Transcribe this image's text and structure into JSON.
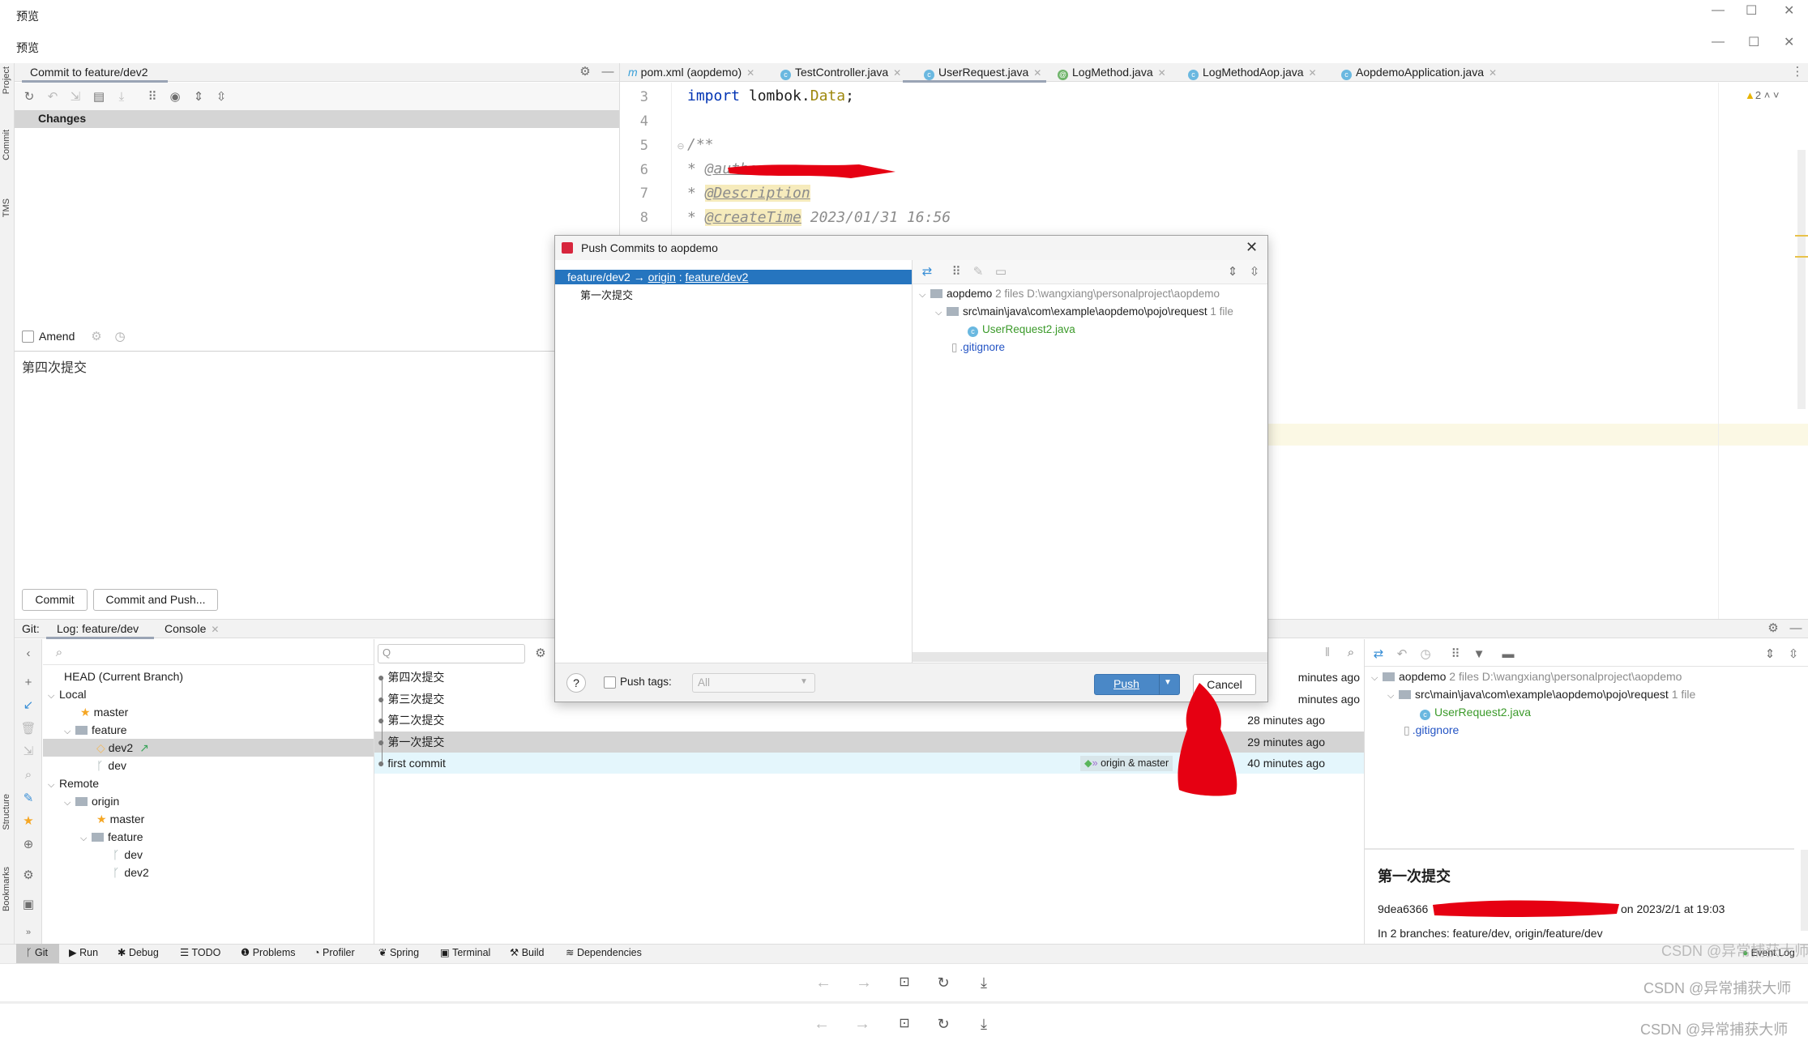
{
  "preview_window": {
    "title_1": "预览",
    "title_2": "预览",
    "controls": [
      "minimize",
      "maximize",
      "close"
    ]
  },
  "side_stripe": {
    "left_top": [
      "Project",
      "Commit",
      "TMS"
    ],
    "left_bottom": [
      "Structure",
      "Bookmarks"
    ]
  },
  "commit_panel": {
    "title": "Commit to feature/dev2",
    "changes_header": "Changes",
    "amend_label": "Amend",
    "amend_checked": false,
    "message": "第四次提交",
    "commit_button": "Commit",
    "commit_push_button": "Commit and Push..."
  },
  "editor": {
    "tabs": [
      {
        "label": "pom.xml (aopdemo)",
        "icon": "maven-icon"
      },
      {
        "label": "TestController.java",
        "icon": "class-icon"
      },
      {
        "label": "UserRequest.java",
        "icon": "class-icon",
        "active": true
      },
      {
        "label": "LogMethod.java",
        "icon": "annotation-icon"
      },
      {
        "label": "LogMethodAop.java",
        "icon": "class-icon"
      },
      {
        "label": "AopdemoApplication.java",
        "icon": "spring-app-icon"
      }
    ],
    "warnings_count": "2",
    "lines": [
      {
        "n": "3",
        "kw": "import",
        "rest": " lombok.",
        "cls": "Data",
        "end": ";"
      },
      {
        "n": "4"
      },
      {
        "n": "5",
        "text": "/**"
      },
      {
        "n": "6",
        "prefix": " * ",
        "tag": "@author"
      },
      {
        "n": "7",
        "prefix": " * ",
        "tag": "@Description"
      },
      {
        "n": "8",
        "prefix": " * ",
        "tag": "@createTime",
        "rest": " 2023/01/31 16:56"
      }
    ]
  },
  "git_panel": {
    "tabs": {
      "prefix": "Git:",
      "log": "Log: feature/dev",
      "console": "Console"
    },
    "branches": {
      "head": "HEAD (Current Branch)",
      "local": "Local",
      "local_master": "master",
      "local_feature": "feature",
      "local_dev2": "dev2",
      "local_dev": "dev",
      "remote": "Remote",
      "origin": "origin",
      "origin_master": "master",
      "origin_feature": "feature",
      "origin_dev": "dev",
      "origin_dev2": "dev2"
    },
    "log_search_placeholder": "Q",
    "commits": [
      {
        "message": "第四次提交",
        "time": "minutes ago"
      },
      {
        "message": "第三次提交",
        "time": "minutes ago"
      },
      {
        "message": "第二次提交",
        "time": "28 minutes ago"
      },
      {
        "message": "第一次提交",
        "time": "29 minutes ago",
        "selected": true
      },
      {
        "message": "first commit",
        "time": "40 minutes ago",
        "tag": "origin & master"
      }
    ],
    "details": {
      "root": "aopdemo",
      "root_meta": "2 files  D:\\wangxiang\\personalproject\\aopdemo",
      "dir": "src\\main\\java\\com\\example\\aopdemo\\pojo\\request",
      "dir_meta": "1 file",
      "file1": "UserRequest2.java",
      "file2": ".gitignore",
      "commit_title": "第一次提交",
      "hash": "9dea6366",
      "date": "on 2023/2/1 at 19:03",
      "branches": "In 2 branches: feature/dev, origin/feature/dev"
    }
  },
  "tool_strip": [
    "Git",
    "Run",
    "Debug",
    "TODO",
    "Problems",
    "Profiler",
    "Spring",
    "Terminal",
    "Build",
    "Dependencies"
  ],
  "event_log": "Event Log",
  "watermark": "CSDN @异常捕获大师",
  "push_dialog": {
    "title": "Push Commits to aopdemo",
    "branch_src": "feature/dev2",
    "arrow": "→",
    "remote": "origin",
    "sep": ":",
    "branch_dst": "feature/dev2",
    "commit": "第一次提交",
    "root": "aopdemo",
    "root_meta": "2 files  D:\\wangxiang\\personalproject\\aopdemo",
    "dir": "src\\main\\java\\com\\example\\aopdemo\\pojo\\request",
    "dir_meta": "1 file",
    "file1": "UserRequest2.java",
    "file2": ".gitignore",
    "help": "?",
    "push_tags_label": "Push tags:",
    "push_tags_checked": false,
    "push_tags_value": "All",
    "push_button": "Push",
    "cancel_button": "Cancel"
  },
  "colors": {
    "accent": "#2675bf",
    "push_button": "#4a88c7",
    "selected_row": "#d4d4d4",
    "highlight_row": "#e4f6fc",
    "redaction": "#e60012"
  }
}
